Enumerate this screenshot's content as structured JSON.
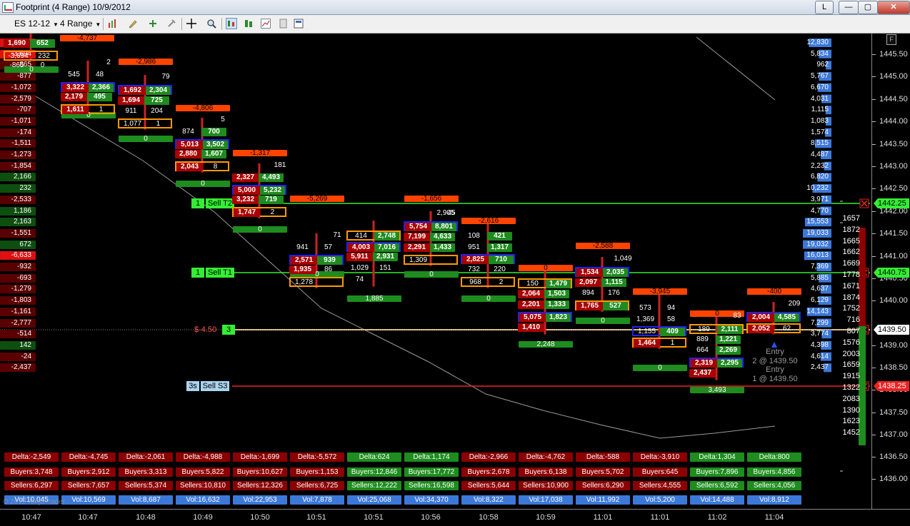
{
  "window": {
    "title": "Footprint (4 Range)  10/9/2012",
    "buttons": {
      "extra": "L",
      "minimize": "—",
      "maximize": "▢",
      "close": "✕"
    }
  },
  "toolbar": {
    "instrument": "ES 12-12",
    "interval": "4 Range",
    "icons": [
      "bar-chart-icon",
      "pencil-icon",
      "plus-icon",
      "pin-icon",
      "crosshair-icon",
      "zoom-icon",
      "chart-style-icon",
      "candles-icon",
      "line-chart-icon",
      "page-icon",
      "properties-icon"
    ]
  },
  "price_axis": {
    "labels": [
      "1445.50",
      "1445.00",
      "1444.50",
      "1444.00",
      "1443.50",
      "1443.00",
      "1442.50",
      "1442.00",
      "1441.50",
      "1441.00",
      "1440.50",
      "1440.00",
      "1439.00",
      "1438.50",
      "1438.00",
      "1437.50",
      "1437.00",
      "1436.50",
      "1436.00"
    ],
    "markers": [
      {
        "label": "1442.25",
        "color": "#33ee33",
        "text_color": "#000000"
      },
      {
        "label": "1440.75",
        "color": "#33ee33",
        "text_color": "#000000"
      },
      {
        "label": "1439.50",
        "color": "#ffffff",
        "text_color": "#000000"
      },
      {
        "label": "1438.25",
        "color": "#ee2222",
        "text_color": "#ffffff"
      }
    ],
    "f_button": "F"
  },
  "time_axis": [
    "10:47",
    "10:47",
    "10:48",
    "10:49",
    "10:50",
    "10:51",
    "10:51",
    "10:56",
    "10:58",
    "10:59",
    "11:01",
    "11:01",
    "11:02",
    "11:04"
  ],
  "left_delta_column": [
    "1,690",
    "-3,694",
    "-865",
    "-877",
    "-1,072",
    "-2,579",
    "-707",
    "-1,071",
    "-174",
    "-1,511",
    "-1,273",
    "-1,854",
    "2,166",
    "232",
    "-2,533",
    "1,186",
    "2,163",
    "-1,551",
    "672",
    "-6,633",
    "-932",
    "-693",
    "-1,279",
    "-1,803",
    "-1,161",
    "-2,777",
    "-514",
    "142",
    "-24",
    "-2,437"
  ],
  "right_volume_column": [
    "12,830",
    "5,834",
    "962",
    "5,767",
    "6,670",
    "4,031",
    "1,115",
    "1,083",
    "1,574",
    "8,515",
    "4,487",
    "2,232",
    "6,820",
    "10,232",
    "3,971",
    "4,770",
    "15,553",
    "19,033",
    "19,032",
    "16,013",
    "7,369",
    "5,885",
    "4,637",
    "6,129",
    "14,143",
    "7,299",
    "3,774",
    "4,398",
    "4,614",
    "2,437"
  ],
  "right_extra_column": [
    "1657",
    "1872",
    "1665",
    "1662",
    "1669",
    "1778",
    "1671",
    "1874",
    "1752",
    "716",
    "807",
    "1576",
    "2003",
    "1659",
    "1915",
    "1322",
    "2083",
    "1390",
    "1623",
    "1452"
  ],
  "order_lines": [
    {
      "qty": "1",
      "label": "Sell T2",
      "color": "#33ee33"
    },
    {
      "qty": "1",
      "label": "Sell T1",
      "color": "#33ee33"
    },
    {
      "qty": "3",
      "label": "$-4.50",
      "color": "#e8c98a"
    },
    {
      "qty": "3s",
      "label": "Sell S3",
      "color": "#ee2222"
    }
  ],
  "entry_labels": [
    "Entry",
    "2 @ 1439.50",
    "Entry",
    "1 @ 1439.50"
  ],
  "bar_summaries": [
    {
      "delta": "Delta:-2,549",
      "buyers": "Buyers:3,748",
      "sellers": "Sellers:6,297",
      "vol": "Vol:10,045"
    },
    {
      "delta": "Delta:-4,745",
      "buyers": "Buyers:2,912",
      "sellers": "Sellers:7,657",
      "vol": "Vol:10,569"
    },
    {
      "delta": "Delta:-2,061",
      "buyers": "Buyers:3,313",
      "sellers": "Sellers:5,374",
      "vol": "Vol:8,687"
    },
    {
      "delta": "Delta:-4,988",
      "buyers": "Buyers:5,822",
      "sellers": "Sellers:10,810",
      "vol": "Vol:16,632"
    },
    {
      "delta": "Delta:-1,699",
      "buyers": "Buyers:10,627",
      "sellers": "Sellers:12,326",
      "vol": "Vol:22,953"
    },
    {
      "delta": "Delta:-5,572",
      "buyers": "Buyers:1,153",
      "sellers": "Sellers:6,725",
      "vol": "Vol:7,878"
    },
    {
      "delta": "Delta:624",
      "buyers": "Buyers:12,846",
      "sellers": "Sellers:12,222",
      "vol": "Vol:25,068"
    },
    {
      "delta": "Delta:1,174",
      "buyers": "Buyers:17,772",
      "sellers": "Sellers:16,598",
      "vol": "Vol:34,370"
    },
    {
      "delta": "Delta:-2,966",
      "buyers": "Buyers:2,678",
      "sellers": "Sellers:5,644",
      "vol": "Vol:8,322"
    },
    {
      "delta": "Delta:-4,762",
      "buyers": "Buyers:6,138",
      "sellers": "Sellers:10,900",
      "vol": "Vol:17,038"
    },
    {
      "delta": "Delta:-588",
      "buyers": "Buyers:5,702",
      "sellers": "Sellers:6,290",
      "vol": "Vol:11,992"
    },
    {
      "delta": "Delta:-3,910",
      "buyers": "Buyers:645",
      "sellers": "Sellers:4,555",
      "vol": "Vol:5,200"
    },
    {
      "delta": "Delta:1,304",
      "buyers": "Buyers:7,896",
      "sellers": "Sellers:6,592",
      "vol": "Vol:14,488"
    },
    {
      "delta": "Delta:800",
      "buyers": "Buyers:4,856",
      "sellers": "Sellers:4,056",
      "vol": "Vol:8,912"
    }
  ],
  "bar_headers": [
    "-4,737",
    "-2,986",
    "-4,806",
    "-1,317",
    "-5,269",
    "-1,656",
    "-2,616",
    "0",
    "-2,588",
    "-3,945",
    "0",
    "-400"
  ],
  "bar_footers": [
    "0",
    "0",
    "0",
    "0",
    "0",
    "0",
    "1,885",
    "0",
    "0",
    "2,248",
    "0",
    "0",
    "3,493"
  ],
  "footprints": [
    {
      "rows": [
        [
          "1,690",
          "652"
        ],
        [
          "-3,694",
          "232"
        ],
        [
          "-865",
          "0"
        ]
      ]
    },
    {
      "rows": [
        [
          "545",
          "48"
        ],
        [
          "3,322",
          "2,366"
        ],
        [
          "2,179",
          "495"
        ],
        [
          "1,611",
          "1"
        ]
      ],
      "top": "2"
    },
    {
      "rows": [
        [
          "1,692",
          "2,304"
        ],
        [
          "1,694",
          "725"
        ],
        [
          "911",
          "204"
        ],
        [
          "1,077",
          "1"
        ]
      ],
      "top": "79"
    },
    {
      "rows": [
        [
          "874",
          "700"
        ],
        [
          "5,013",
          "3,502"
        ],
        [
          "2,880",
          "1,607"
        ],
        [
          "2,043",
          "8"
        ]
      ],
      "top": "5"
    },
    {
      "rows": [
        [
          "2,327",
          "4,493"
        ],
        [
          "5,000",
          "5,232"
        ],
        [
          "3,232",
          "719"
        ],
        [
          "1,747",
          "2"
        ]
      ],
      "top": "181"
    },
    {
      "rows": [
        [
          "941",
          "57"
        ],
        [
          "2,571",
          "939"
        ],
        [
          "1,935",
          "86"
        ],
        [
          "1,278",
          ""
        ]
      ],
      "top": "71"
    },
    {
      "rows": [
        [
          "414",
          "2,748"
        ],
        [
          "4,003",
          "7,016"
        ],
        [
          "5,911",
          "2,931"
        ],
        [
          "1,029",
          "151"
        ],
        [
          "74",
          ""
        ]
      ]
    },
    {
      "rows": [
        [
          "5,754",
          "8,801"
        ],
        [
          "7,199",
          "4,633"
        ],
        [
          "2,291",
          "1,433"
        ],
        [
          "1,309",
          ""
        ]
      ],
      "top": "45",
      "top2": "2,905"
    },
    {
      "rows": [
        [
          "108",
          "421"
        ],
        [
          "951",
          "1,317"
        ],
        [
          "2,825",
          "710"
        ],
        [
          "732",
          "220"
        ],
        [
          "968",
          "2"
        ]
      ]
    },
    {
      "rows": [
        [
          "150",
          "1,479"
        ],
        [
          "2,064",
          "1,503"
        ],
        [
          "2,201",
          "1,333"
        ],
        [
          "5,075",
          "1,823"
        ],
        [
          "1,410",
          ""
        ]
      ]
    },
    {
      "rows": [
        [
          "1,534",
          "2,035"
        ],
        [
          "2,097",
          "1,115"
        ],
        [
          "894",
          "176"
        ],
        [
          "1,765",
          "527"
        ]
      ],
      "top": "1,049"
    },
    {
      "rows": [
        [
          "573",
          "94"
        ],
        [
          "1,369",
          "58"
        ],
        [
          "1,155",
          "409"
        ],
        [
          "1,464",
          "1"
        ]
      ]
    },
    {
      "rows": [
        [
          "189",
          "2,111"
        ],
        [
          "889",
          "1,221"
        ],
        [
          "664",
          "2,269"
        ],
        [
          "2,319",
          "2,295"
        ],
        [
          "2,437",
          ""
        ]
      ],
      "top": "83"
    },
    {
      "rows": [
        [
          "2,004",
          "4,585"
        ],
        [
          "2,052",
          "62"
        ]
      ],
      "top": "209"
    }
  ],
  "colors": {
    "bid_red": "#aa0000",
    "ask_green": "#1f8a1f",
    "imbalance_blue": "#2222ee",
    "extreme_orange": "#ff9900",
    "header_orange": "#ff4400",
    "delta_neg": "#8b0000",
    "delta_pos": "#1e8c1e",
    "vol_blue": "#3c78d8"
  },
  "watermark": "© 2012 NinjaTrader"
}
